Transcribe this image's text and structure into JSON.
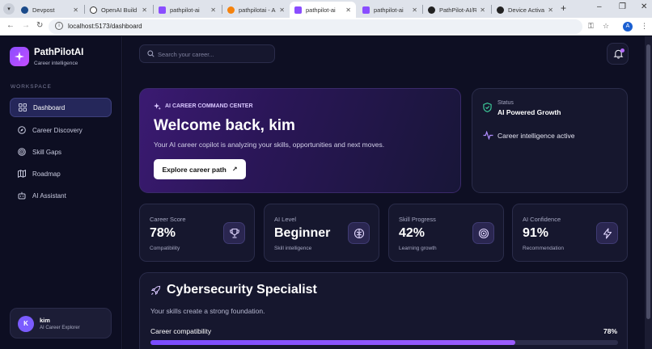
{
  "browser": {
    "tabs": [
      {
        "title": "Devpost",
        "color": "#1a4a8a"
      },
      {
        "title": "OpenAI Build W",
        "color": "#222222"
      },
      {
        "title": "pathpilot-ai",
        "color": "#8a4dff"
      },
      {
        "title": "pathpilotai - Aut",
        "color": "#f5820c"
      },
      {
        "title": "pathpilot-ai",
        "color": "#8a4dff"
      },
      {
        "title": "pathpilot-ai",
        "color": "#8a4dff"
      },
      {
        "title": "PathPilot-AI/RE",
        "color": "#222222"
      },
      {
        "title": "Device Activation",
        "color": "#222222"
      }
    ],
    "url": "localhost:5173/dashboard",
    "profile_initial": "A"
  },
  "sidebar": {
    "brand": "PathPilotAI",
    "tagline": "Career intelligence",
    "section_label": "WORKSPACE",
    "items": [
      {
        "label": "Dashboard",
        "icon": "grid-icon"
      },
      {
        "label": "Career Discovery",
        "icon": "compass-icon"
      },
      {
        "label": "Skill Gaps",
        "icon": "target-icon"
      },
      {
        "label": "Roadmap",
        "icon": "map-icon"
      },
      {
        "label": "AI Assistant",
        "icon": "bot-icon"
      }
    ],
    "user": {
      "initial": "K",
      "name": "kim",
      "role": "AI Career Explorer"
    }
  },
  "header": {
    "search_placeholder": "Search your career..."
  },
  "hero": {
    "tag": "AI CAREER COMMAND CENTER",
    "title": "Welcome back, kim",
    "subtitle": "Your AI career copilot is analyzing your skills, opportunities and next moves.",
    "button_label": "Explore career path",
    "button_arrow": "↗"
  },
  "status": {
    "label": "Status",
    "value": "AI Powered Growth",
    "note": "Career intelligence active"
  },
  "stats": [
    {
      "label": "Career Score",
      "value": "78%",
      "sub": "Compatibility",
      "icon": "trophy-icon"
    },
    {
      "label": "AI Level",
      "value": "Beginner",
      "sub": "Skill intelligence",
      "icon": "brain-icon"
    },
    {
      "label": "Skill Progress",
      "value": "42%",
      "sub": "Learning growth",
      "icon": "target-icon"
    },
    {
      "label": "AI Confidence",
      "value": "91%",
      "sub": "Recommendation",
      "icon": "bolt-icon"
    }
  ],
  "specialist": {
    "title": "Cybersecurity Specialist",
    "description": "Your skills create a strong foundation.",
    "compat_label": "Career compatibility",
    "compat_percent": "78%",
    "compat_value": 78
  },
  "colors": {
    "accent": "#8a4dff",
    "background": "#0e0f23",
    "card": "#16172e"
  }
}
